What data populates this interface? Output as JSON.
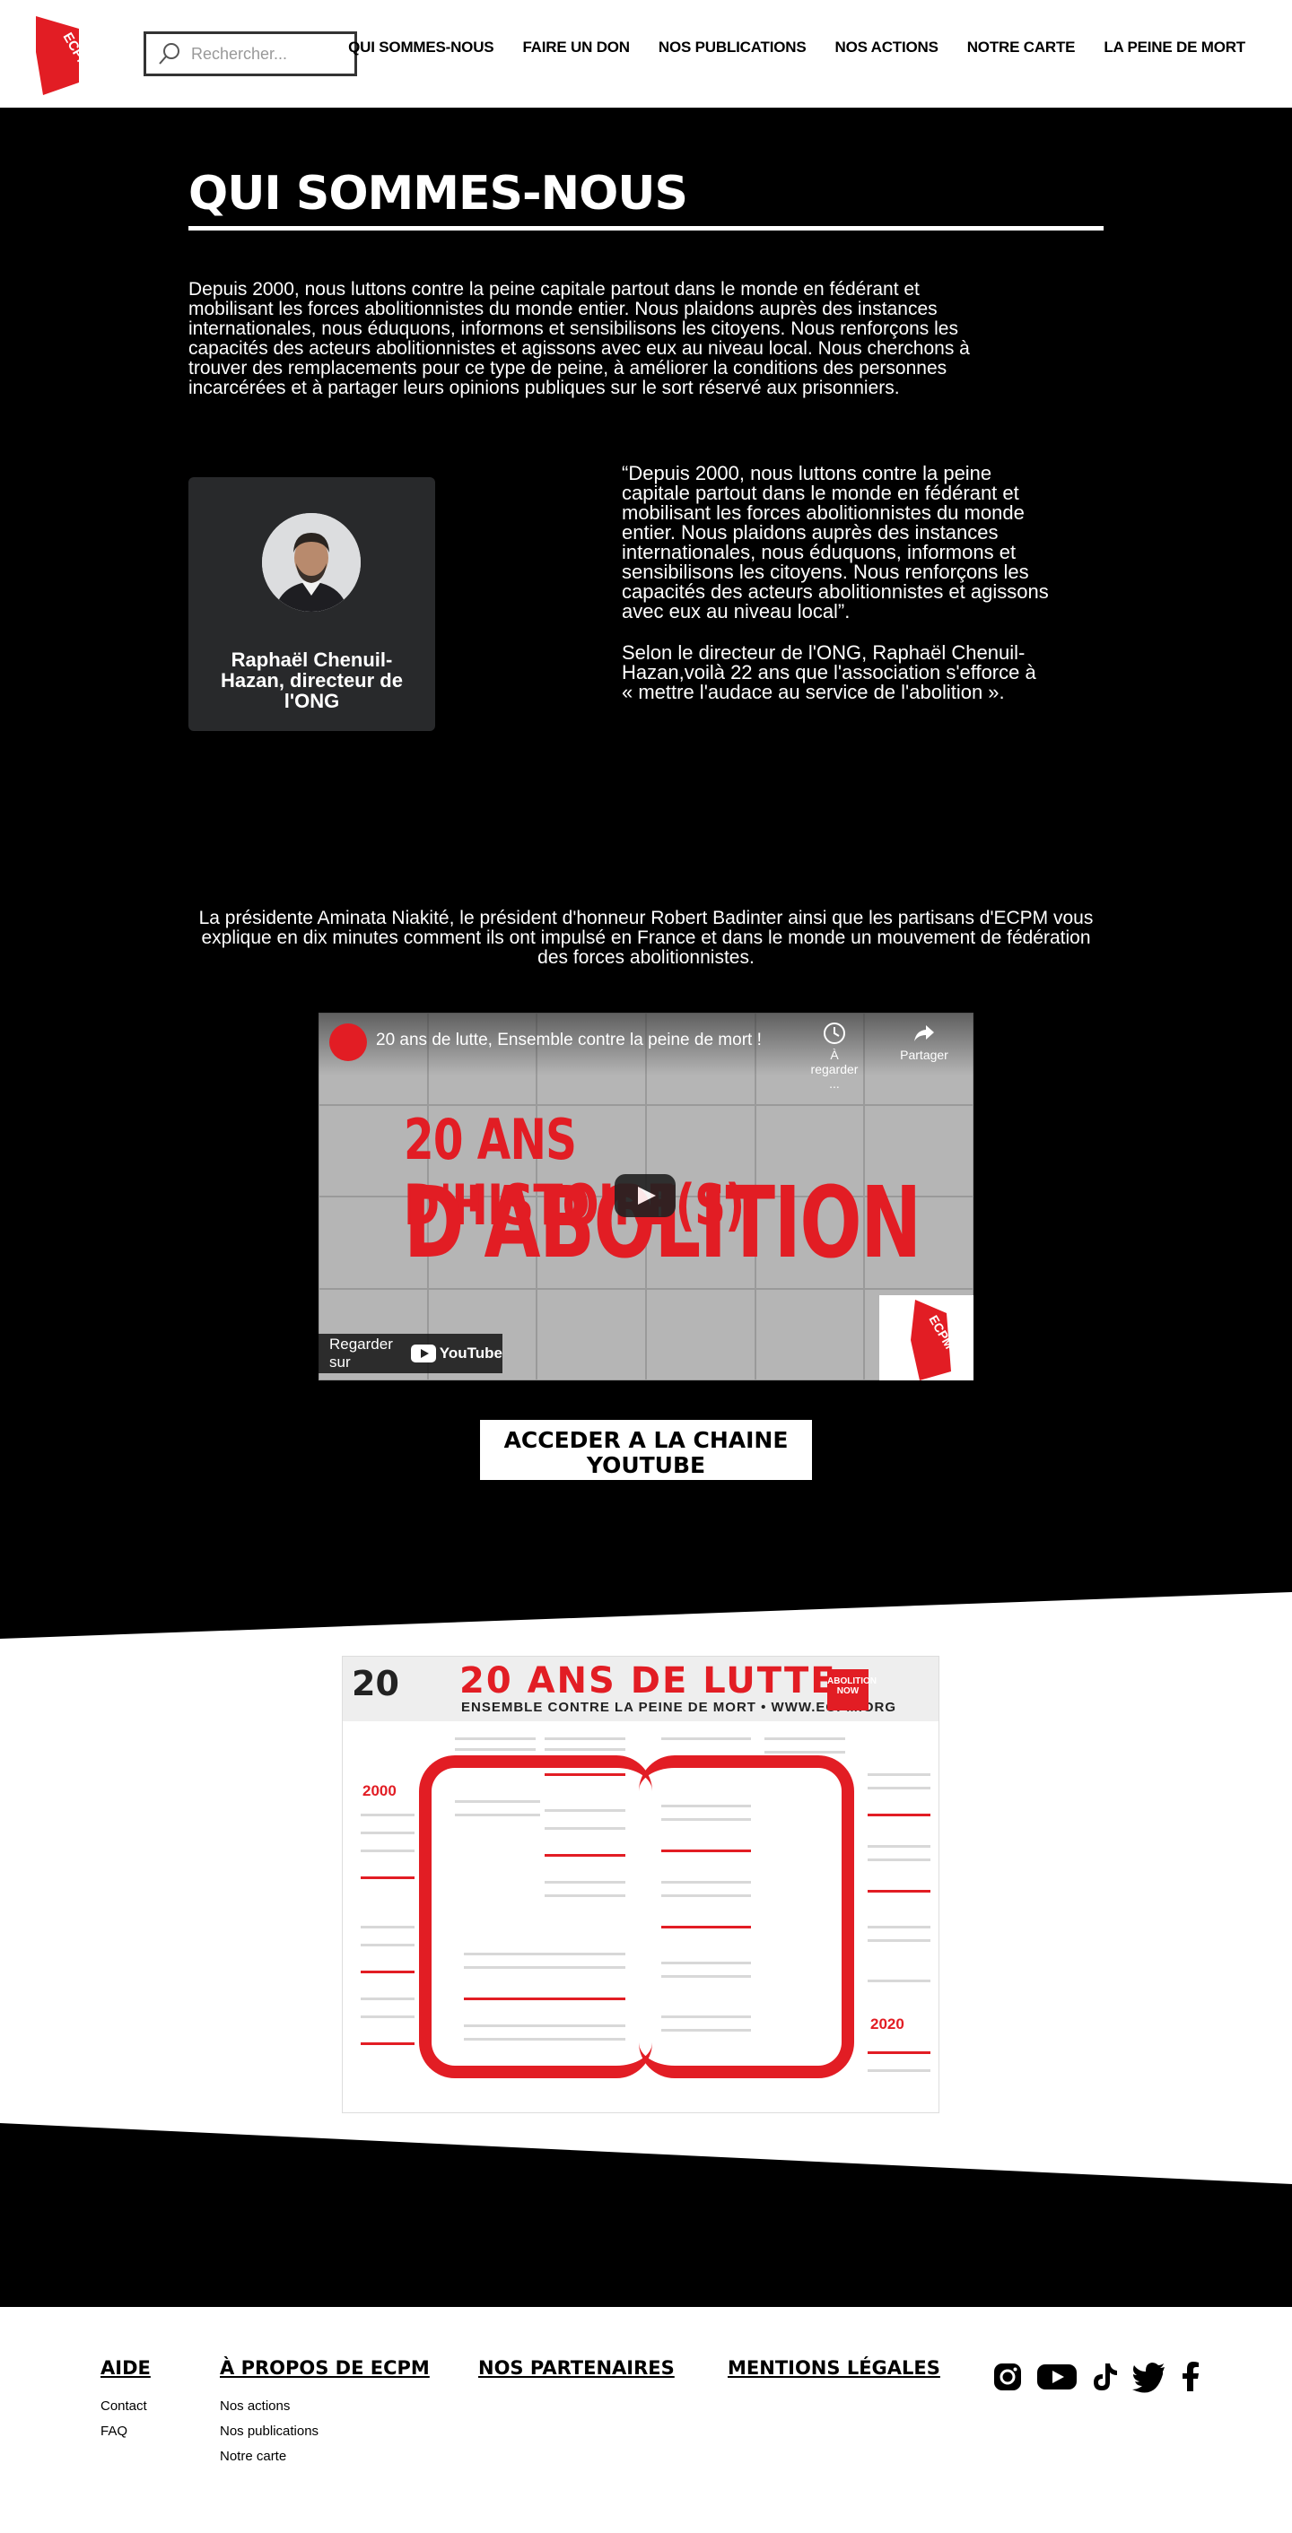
{
  "header": {
    "logo_text": "ECPM",
    "search": {
      "placeholder": "Rechercher..."
    },
    "nav": [
      "QUI SOMMES-NOUS",
      "FAIRE UN DON",
      "NOS PUBLICATIONS",
      "NOS ACTIONS",
      "NOTRE CARTE",
      "LA PEINE DE MORT"
    ]
  },
  "main": {
    "title": "QUI SOMMES-NOUS",
    "intro": "Depuis 2000, nous luttons contre la peine capitale partout dans le monde en fédérant et mobilisant les forces abolitionnistes du monde entier. Nous plaidons auprès des instances internationales, nous éduquons, informons et sensibilisons les citoyens. Nous renforçons les capacités des acteurs abolitionnistes et agissons avec eux au niveau local. Nous cherchons à trouver des remplacements pour ce type de peine, à améliorer la conditions des personnes incarcérées et à partager leurs opinions publiques sur le sort  réservé aux prisonniers.",
    "director_card": {
      "name": "Raphaël Chenuil-Hazan, directeur de l'ONG"
    },
    "quote": {
      "text": "“Depuis 2000, nous luttons contre la peine capitale partout dans le monde en fédérant et mobilisant les forces abolitionnistes du monde entier. Nous plaidons auprès des instances internationales, nous éduquons, informons et sensibilisons les citoyens. Nous renforçons les capacités des acteurs abolitionnistes et agissons avec eux au niveau local”.",
      "caption": "Selon le directeur de l'ONG, Raphaël Chenuil-Hazan,voilà 22 ans que l'association s'efforce à « mettre l'audace au service de l'abolition »."
    },
    "video_intro": "La présidente Aminata Niakité, le président d'honneur Robert Badinter ainsi que les partisans d'ECPM vous explique en dix minutes comment ils ont impulsé en France et dans le monde un mouvement de fédération des forces abolitionnistes.",
    "video": {
      "title": "20 ans de lutte, Ensemble contre la peine de mort !",
      "later": "À regarder ...",
      "share": "Partager",
      "headline_1": "20 ANS D'HISTOIRE(S)",
      "headline_2": "D'ABOLITION",
      "watch_on": "Regarder sur",
      "youtube": "YouTube",
      "logo_text": "ECPM"
    },
    "youtube_button": "ACCEDER A LA CHAINE YOUTUBE"
  },
  "poster": {
    "title": "20 ANS DE LUTTE",
    "subtitle": "ENSEMBLE CONTRE LA PEINE DE MORT   •   WWW.ECPM.ORG",
    "badge_20": "20",
    "badge_now": "ABOLITION NOW",
    "year_start": "2000",
    "year_end": "2020"
  },
  "footer": {
    "aide": {
      "title": "AIDE",
      "links": [
        "Contact",
        "FAQ"
      ]
    },
    "apropos": {
      "title": "À PROPOS DE ECPM",
      "links": [
        "Nos actions",
        "Nos publications",
        "Notre carte"
      ]
    },
    "partenaires": {
      "title": "NOS PARTENAIRES"
    },
    "mentions": {
      "title": "MENTIONS LÉGALES"
    },
    "socials": [
      "instagram-icon",
      "youtube-icon",
      "tiktok-icon",
      "twitter-icon",
      "facebook-icon"
    ]
  },
  "colors": {
    "brand_red": "#e21d24",
    "card_bg": "#28292b"
  }
}
